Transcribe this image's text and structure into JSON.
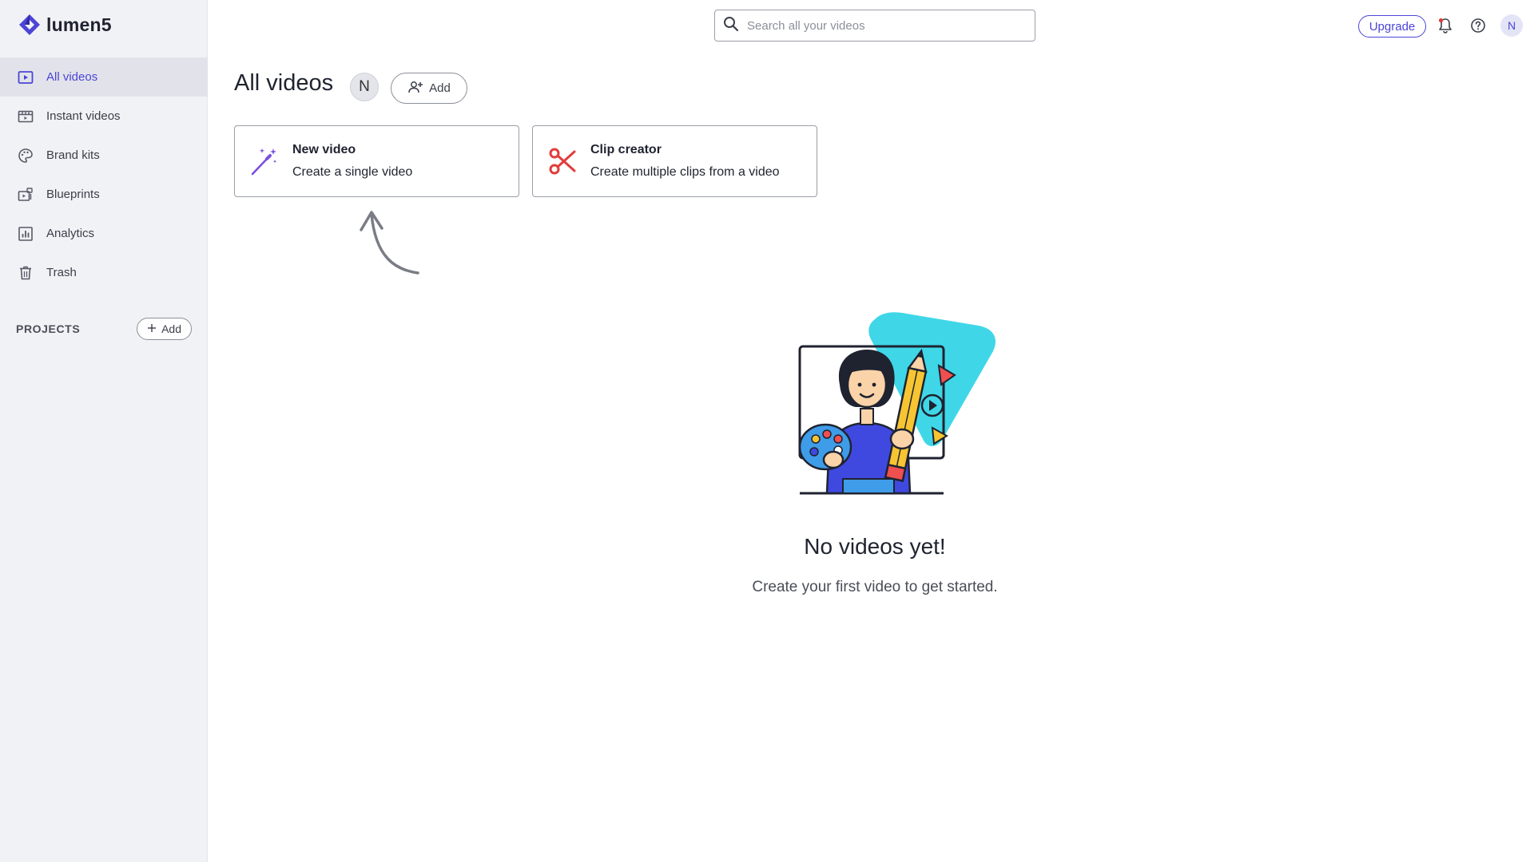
{
  "app": {
    "logo_text": "lumen5"
  },
  "sidebar": {
    "items": [
      {
        "label": "All videos",
        "icon": "video-play-icon",
        "active": true
      },
      {
        "label": "Instant videos",
        "icon": "film-strip-icon",
        "active": false
      },
      {
        "label": "Brand kits",
        "icon": "palette-icon",
        "active": false
      },
      {
        "label": "Blueprints",
        "icon": "blueprint-icon",
        "active": false
      },
      {
        "label": "Analytics",
        "icon": "bar-chart-icon",
        "active": false
      },
      {
        "label": "Trash",
        "icon": "trash-icon",
        "active": false
      }
    ],
    "projects_label": "PROJECTS",
    "projects_add_label": "Add"
  },
  "header": {
    "search_placeholder": "Search all your videos",
    "upgrade_label": "Upgrade",
    "avatar_initial": "N"
  },
  "main": {
    "title": "All videos",
    "member_initial": "N",
    "add_member_label": "Add",
    "cards": [
      {
        "title": "New video",
        "subtitle": "Create a single video",
        "icon": "magic-wand-icon"
      },
      {
        "title": "Clip creator",
        "subtitle": "Create multiple clips from a video",
        "icon": "scissors-icon"
      }
    ],
    "empty_title": "No videos yet!",
    "empty_subtitle": "Create your first video to get started."
  },
  "colors": {
    "accent": "#4c45d6",
    "sidebar_bg": "#f1f2f5",
    "scissors_red": "#e23c3c",
    "wand_purple": "#7b4fe0",
    "illustration_teal": "#3fd7e8"
  }
}
